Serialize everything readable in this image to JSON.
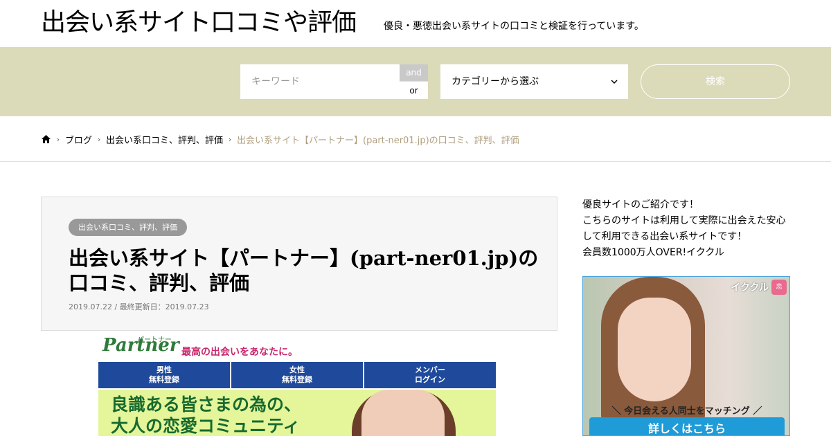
{
  "header": {
    "site_title": "出会い系サイト口コミや評価",
    "site_description": "優良・悪徳出会い系サイトの口コミと検証を行っています。"
  },
  "search": {
    "keyword_placeholder": "キーワード",
    "and_label": "and",
    "or_label": "or",
    "category_selected": "カテゴリーから選ぶ",
    "submit_label": "検索"
  },
  "breadcrumb": {
    "items": [
      {
        "label": "ブログ"
      },
      {
        "label": "出会い系口コミ、評判、評価"
      },
      {
        "label": "出会い系サイト【パートナー】(part-ner01.jp)の口コミ、評判、評価"
      }
    ]
  },
  "article": {
    "category": "出会い系口コミ、評判、評価",
    "title": "出会い系サイト【パートナー】(part-ner01.jp)の口コミ、評判、評価",
    "date": "2019.07.22 / 最終更新日：2019.07.23",
    "feature_image": {
      "logo": "Partner",
      "logo_sub": "パートナー",
      "tagline": "最高の出会いをあなたに。",
      "nav": [
        "男性\n無料登録",
        "女性\n無料登録",
        "メンバー\nログイン"
      ],
      "nav_line1": [
        "男性",
        "女性",
        "メンバー"
      ],
      "nav_line2": [
        "無料登録",
        "無料登録",
        "ログイン"
      ],
      "headline_1": "良識ある皆さまの為の、",
      "headline_2": "大人の恋愛コミュニティ"
    }
  },
  "sidebar": {
    "lines": [
      "優良サイトのご紹介です！",
      "こちらのサイトは利用して実際に出会えた安心",
      "して利用できる出会い系サイトです！",
      "会員数1000万人OVER!イククル"
    ],
    "ad": {
      "brand": "イククル",
      "brand_icon": "恋",
      "match_text": "＼ 今日会える人同士をマッチング ／",
      "cta": "詳しくはこちら"
    }
  }
}
